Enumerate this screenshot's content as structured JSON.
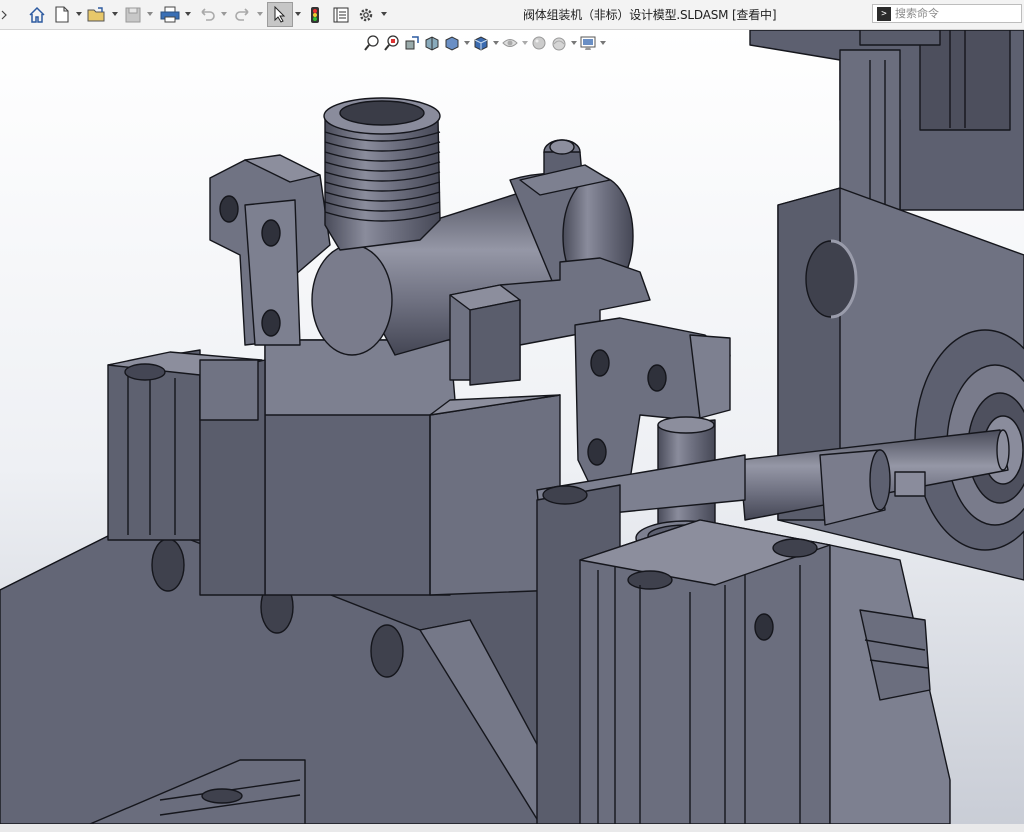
{
  "window": {
    "title": "阀体组装机（非标）设计模型.SLDASM [查看中]"
  },
  "toolbar": {
    "icons": [
      "home-icon",
      "new-document-icon",
      "open-file-icon",
      "save-icon",
      "print-icon",
      "undo-icon",
      "redo-icon",
      "select-cursor-icon",
      "rebuild-icon",
      "file-properties-icon",
      "options-gear-icon"
    ]
  },
  "search": {
    "placeholder": "搜索命令"
  },
  "heads_up_toolbar": {
    "icons": [
      "zoom-to-fit-icon",
      "zoom-to-area-icon",
      "previous-view-icon",
      "section-view-icon",
      "view-orientation-icon",
      "display-style-icon",
      "hide-show-items-icon",
      "edit-appearance-icon",
      "apply-scene-icon",
      "view-settings-icon"
    ]
  },
  "colors": {
    "toolbar_bg": "#f3f3f3",
    "model_face_light": "#7d7f8e",
    "model_face_mid": "#656878",
    "model_face_dark": "#4d4f5d",
    "model_edge": "#15161c",
    "background_top": "#ffffff",
    "background_bottom": "#c9cdd6"
  }
}
